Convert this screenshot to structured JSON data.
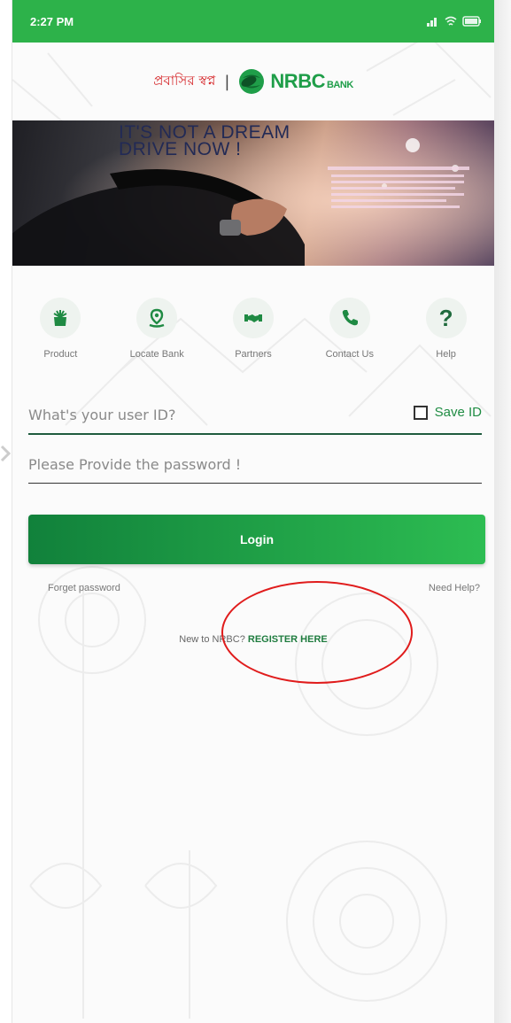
{
  "status": {
    "time": "2:27 PM"
  },
  "brand": {
    "bengali": "প্রবাসির স্বপ্ন",
    "separator": "|",
    "name": "NRBC",
    "suffix": "BANK"
  },
  "banner": {
    "line1": "IT'S NOT A DREAM",
    "line2": "DRIVE NOW !"
  },
  "quick_actions": [
    {
      "label": "Product",
      "icon": "product-icon"
    },
    {
      "label": "Locate Bank",
      "icon": "location-pin-icon"
    },
    {
      "label": "Partners",
      "icon": "handshake-icon"
    },
    {
      "label": "Contact Us",
      "icon": "phone-icon"
    },
    {
      "label": "Help",
      "icon": "question-icon"
    }
  ],
  "login": {
    "user_placeholder": "What's your user ID?",
    "save_id_label": "Save ID",
    "password_placeholder": "Please Provide the password !",
    "login_label": "Login",
    "forget_password": "Forget password",
    "need_help": "Need Help?",
    "register_prefix": "New to NRBC?",
    "register_link": "REGISTER HERE"
  },
  "colors": {
    "brand_green": "#2db24a",
    "button_green": "#11813b",
    "accent_red": "#d6282b",
    "annotation_red": "#e01c1c"
  }
}
